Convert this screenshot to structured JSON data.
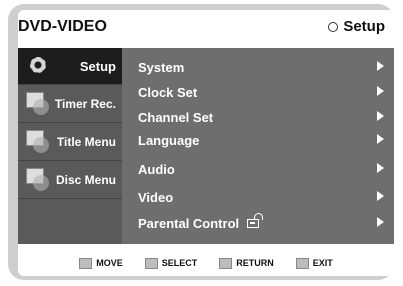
{
  "header": {
    "title": "DVD-VIDEO",
    "mode": "Setup"
  },
  "sidebar": {
    "items": [
      {
        "label": "Setup",
        "icon": "gear-icon",
        "active": true
      },
      {
        "label": "Timer Rec.",
        "icon": "timer-rec-icon",
        "active": false
      },
      {
        "label": "Title Menu",
        "icon": "title-menu-icon",
        "active": false
      },
      {
        "label": "Disc Menu",
        "icon": "disc-menu-icon",
        "active": false
      }
    ]
  },
  "menu": {
    "items": [
      {
        "label": "System"
      },
      {
        "label": "Clock Set"
      },
      {
        "label": "Channel Set"
      },
      {
        "label": "Language"
      },
      {
        "label": "Audio"
      },
      {
        "label": "Video"
      },
      {
        "label": "Parental Control"
      }
    ]
  },
  "footer": {
    "move": "MOVE",
    "select": "SELECT",
    "return": "RETURN",
    "exit": "EXIT"
  },
  "colors": {
    "panel": "#6e6e6e",
    "sidebar": "#5a5a5a",
    "active": "#1d1d1d",
    "text": "#ffffff"
  }
}
